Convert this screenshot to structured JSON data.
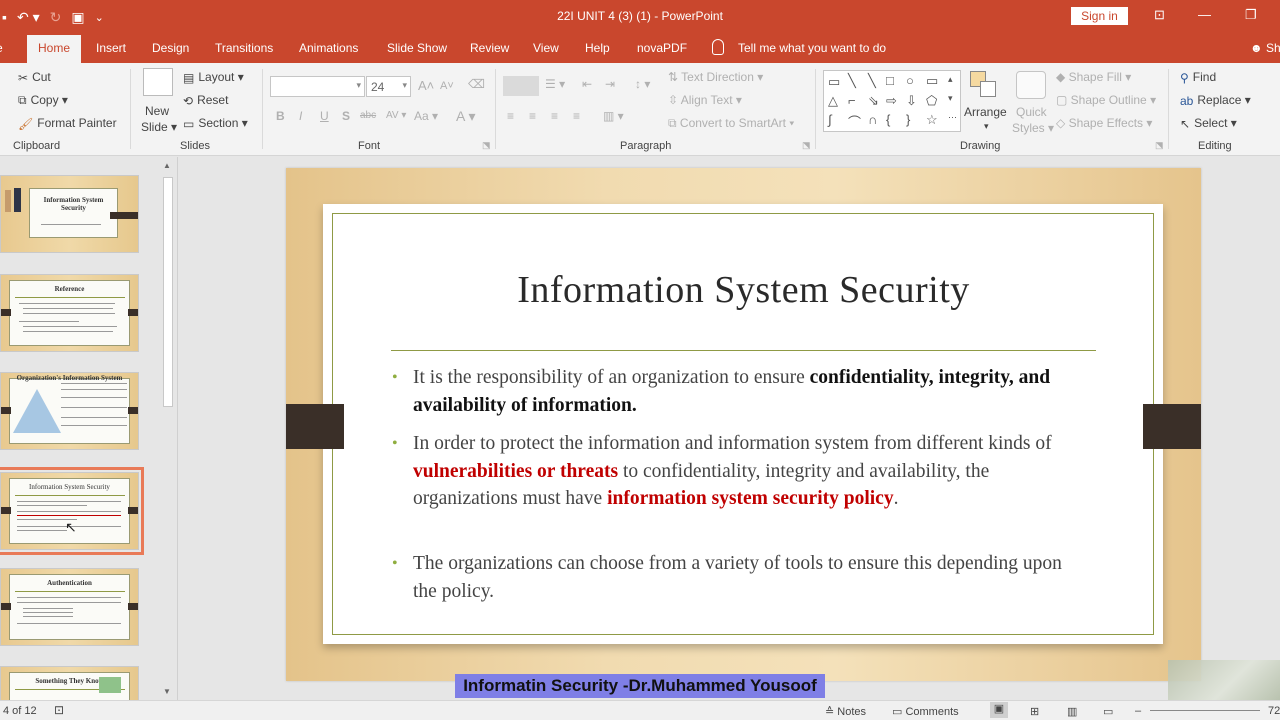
{
  "titlebar": {
    "title": "22I UNIT 4 (3) (1)  -  PowerPoint",
    "sign_in": "Sign in",
    "qat_more": "⌄"
  },
  "tabs": [
    "Home",
    "Insert",
    "Design",
    "Transitions",
    "Animations",
    "Slide Show",
    "Review",
    "View",
    "Help",
    "novaPDF"
  ],
  "tell_me": "Tell me what you want to do",
  "share": "Sh",
  "ribbon": {
    "clipboard": {
      "cut": "Cut",
      "copy": "Copy",
      "format_painter": "Format Painter",
      "label": "Clipboard"
    },
    "slides": {
      "new_slide_1": "New",
      "new_slide_2": "Slide",
      "layout": "Layout",
      "reset": "Reset",
      "section": "Section",
      "label": "Slides"
    },
    "font": {
      "size": "24",
      "bold": "B",
      "italic": "I",
      "underline": "U",
      "shadow": "S",
      "strike": "abc",
      "spacing": "AV",
      "case": "Aa",
      "label": "Font",
      "grow": "A",
      "shrink": "A"
    },
    "paragraph": {
      "text_direction": "Text Direction",
      "align_text": "Align Text",
      "convert": "Convert to SmartArt",
      "label": "Paragraph"
    },
    "drawing": {
      "arrange": "Arrange",
      "quick_styles_1": "Quick",
      "quick_styles_2": "Styles",
      "shape_fill": "Shape Fill",
      "shape_outline": "Shape Outline",
      "shape_effects": "Shape Effects",
      "label": "Drawing"
    },
    "editing": {
      "find": "Find",
      "replace": "Replace",
      "select": "Select",
      "label": "Editing"
    }
  },
  "thumbnails": [
    {
      "title": "Information System Security"
    },
    {
      "title": "Reference"
    },
    {
      "title": "Organization's Information System"
    },
    {
      "title": "Information System Security"
    },
    {
      "title": "Authentication"
    },
    {
      "title": "Something They Know"
    }
  ],
  "slide": {
    "title": "Information System Security",
    "bullets": [
      {
        "pre": "It is the responsibility of an organization to ensure ",
        "bold": "confidentiality, integrity, and availability of information."
      },
      {
        "pre": "In order to protect the information and information system from different kinds of ",
        "red1": "vulnerabilities or threats",
        "mid": " to confidentiality, integrity and availability, the organizations must have ",
        "red2": "information system security policy",
        "post": "."
      },
      {
        "pre": "The organizations can choose from a variety of tools to ensure this depending upon the policy."
      }
    ]
  },
  "caption": "Informatin Security  -Dr.Muhammed Yousoof",
  "status": {
    "slide_count": "4 of 12",
    "notes": "Notes",
    "comments": "Comments",
    "zoom": "72"
  },
  "colors": {
    "accent": "#c9472d",
    "caption_bg": "#7f7fe6",
    "emphasis_red": "#c00000",
    "bullet_green": "#8fae3f"
  }
}
